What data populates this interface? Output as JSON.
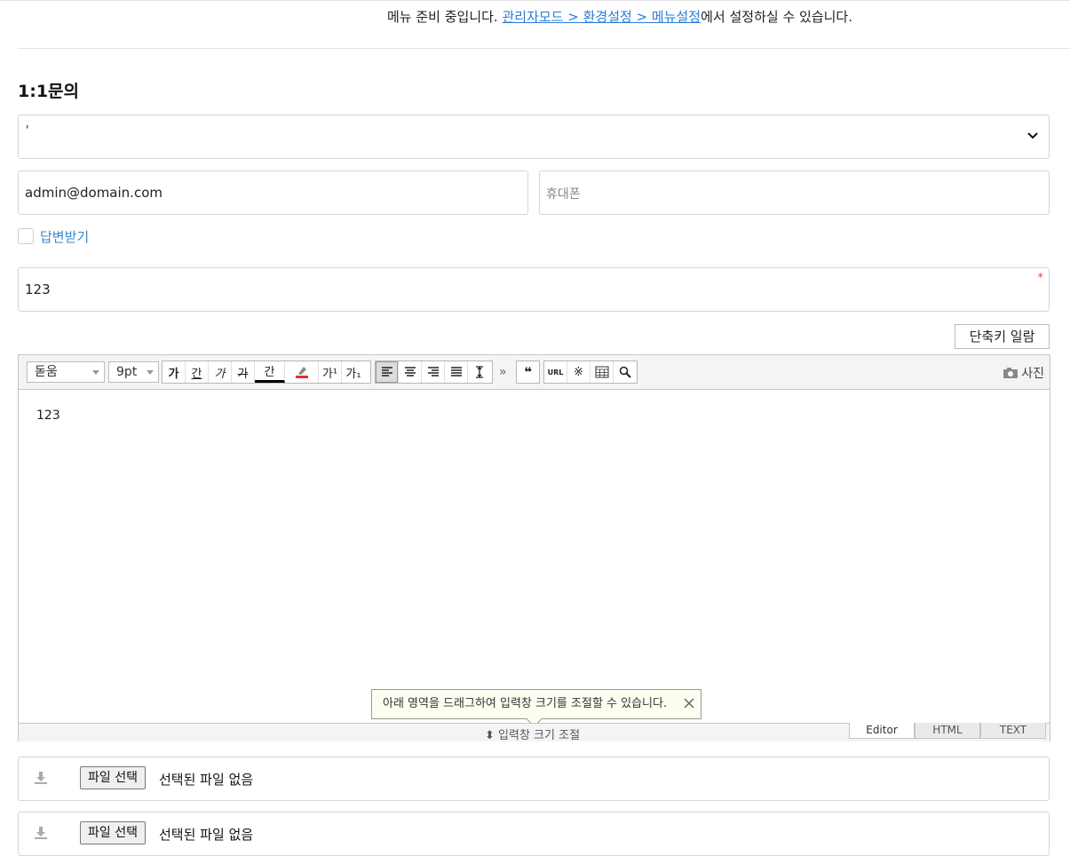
{
  "notice": {
    "prefix": "메뉴 준비 중입니다. ",
    "link": "관리자모드 > 환경설정 > 메뉴설정",
    "suffix": "에서 설정하실 수 있습니다."
  },
  "page_title": "1:1문의",
  "form": {
    "category_value": "'",
    "email_value": "admin@domain.com",
    "phone_placeholder": "휴대폰",
    "receive_reply_label": "답변받기",
    "subject_value": "123",
    "required_mark": "*",
    "shortcut_button": "단축키 일람"
  },
  "editor": {
    "font_family": "돋움",
    "font_size": "9pt",
    "format_buttons": [
      "가",
      "간",
      "가",
      "가",
      "간"
    ],
    "script_buttons": [
      "가¹",
      "가₁"
    ],
    "more": "»",
    "quote": "❝",
    "url": "URL",
    "special_char": "※",
    "photo_label": "사진",
    "content": "123",
    "tooltip": "아래 영역을 드래그하여 입력창 크기를 조절할 수 있습니다.",
    "resize_label": "입력창 크기 조절",
    "resize_arrows": "⬍",
    "modes": [
      "Editor",
      "HTML",
      "TEXT"
    ]
  },
  "files": [
    {
      "button": "파일 선택",
      "status": "선택된 파일 없음"
    },
    {
      "button": "파일 선택",
      "status": "선택된 파일 없음"
    }
  ]
}
